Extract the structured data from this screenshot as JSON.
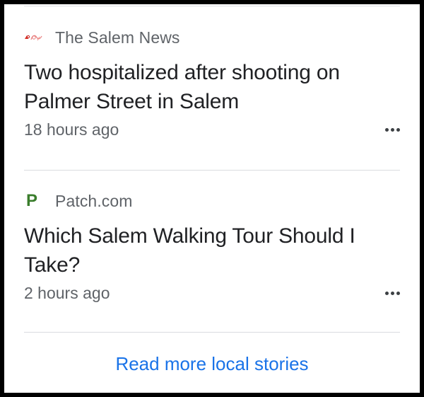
{
  "stories": [
    {
      "source_icon": "salem-news-logo",
      "source": "The Salem News",
      "headline": "Two hospitalized after shooting on Palmer Street in Salem",
      "time": "18 hours ago",
      "menu_icon": "more-options-icon"
    },
    {
      "source_icon": "patch-logo",
      "source_logo_letter": "P",
      "source": "Patch.com",
      "headline": "Which Salem Walking Tour Should I Take?",
      "time": "2 hours ago",
      "menu_icon": "more-options-icon"
    }
  ],
  "footer": {
    "read_more_label": "Read more local stories"
  },
  "colors": {
    "link": "#1a73e8",
    "headline": "#202124",
    "secondary_text": "#5f6368",
    "divider": "#dadce0",
    "patch_green": "#3a7d2c"
  }
}
